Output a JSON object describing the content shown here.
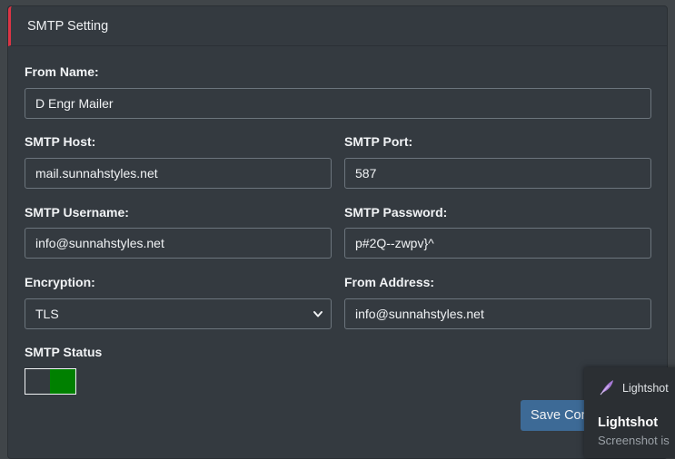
{
  "header": {
    "title": "SMTP Setting"
  },
  "form": {
    "from_name": {
      "label": "From Name:",
      "value": "D Engr Mailer"
    },
    "smtp_host": {
      "label": "SMTP Host:",
      "value": "mail.sunnahstyles.net"
    },
    "smtp_port": {
      "label": "SMTP Port:",
      "value": "587"
    },
    "smtp_username": {
      "label": "SMTP Username:",
      "value": "info@sunnahstyles.net"
    },
    "smtp_password": {
      "label": "SMTP Password:",
      "value": "p#2Q--zwpv}^"
    },
    "encryption": {
      "label": "Encryption:",
      "value": "TLS"
    },
    "from_address": {
      "label": "From Address:",
      "value": "info@sunnahstyles.net"
    },
    "smtp_status": {
      "label": "SMTP Status",
      "enabled": true,
      "on_color": "#008000"
    }
  },
  "actions": {
    "save_label": "Save Con"
  },
  "lightshot": {
    "app_name": "Lightshot",
    "title": "Lightshot",
    "subtitle": "Screenshot is"
  },
  "colors": {
    "accent": "#dc3545",
    "button": "#3d6a96",
    "background": "#343a40"
  }
}
